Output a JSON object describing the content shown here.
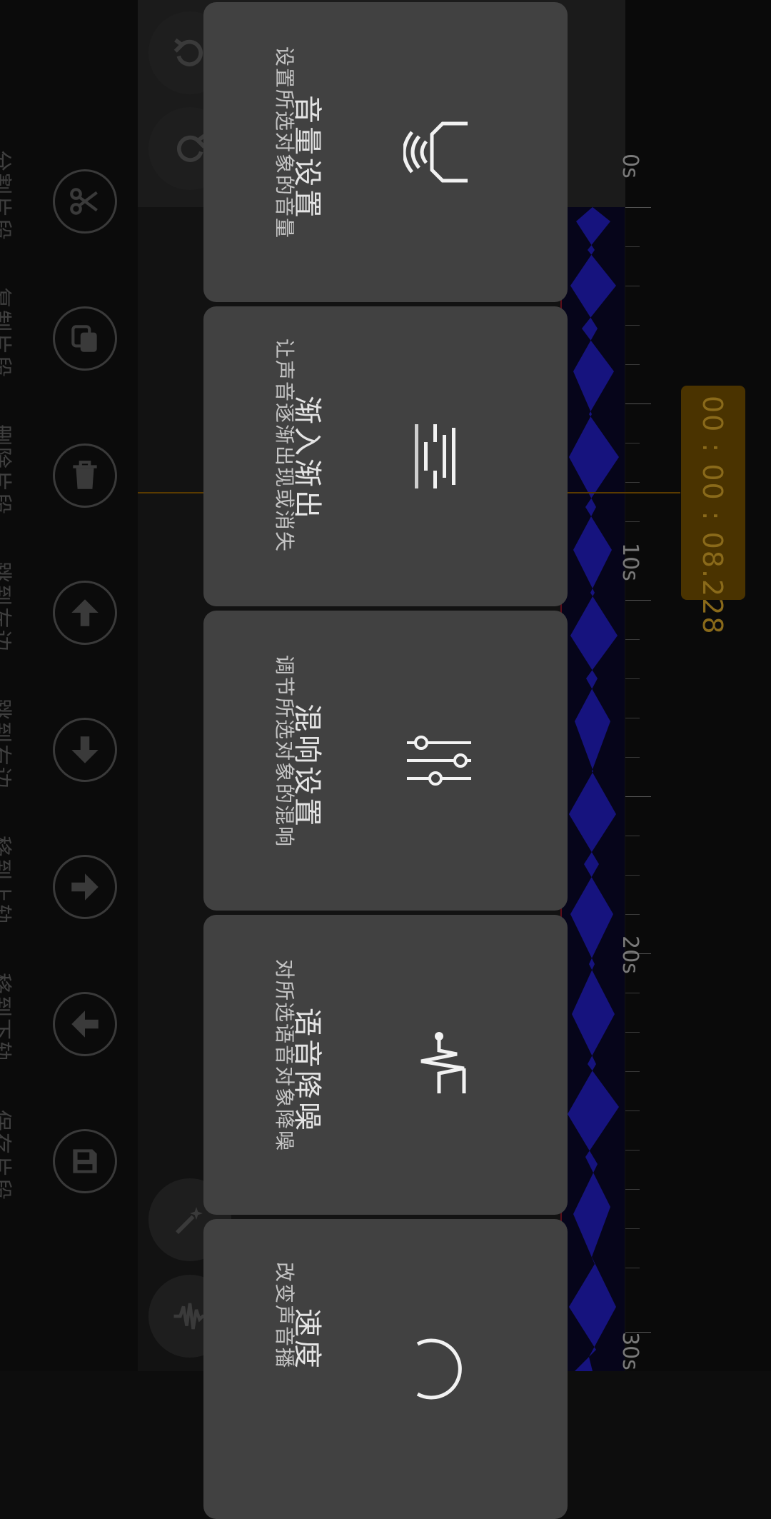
{
  "timeline": {
    "current_time": "00 : 00 : 08.228",
    "ruler_labels": [
      "0s",
      "10s",
      "20s",
      "30s"
    ]
  },
  "tools": [
    {
      "label": "分割片段",
      "icon": "scissors-icon"
    },
    {
      "label": "复制片段",
      "icon": "copy-icon"
    },
    {
      "label": "删除片段",
      "icon": "trash-icon"
    },
    {
      "label": "跳到左边",
      "icon": "arrow-up-icon"
    },
    {
      "label": "跳到右边",
      "icon": "arrow-down-icon"
    },
    {
      "label": "移到上轨",
      "icon": "arrow-right-icon"
    },
    {
      "label": "移到下轨",
      "icon": "arrow-left-icon"
    },
    {
      "label": "保存片段",
      "icon": "save-icon"
    }
  ],
  "menu": [
    {
      "title": "音量设置",
      "desc": "设置所选对象的音量",
      "icon": "speaker-icon"
    },
    {
      "title": "渐入渐出",
      "desc": "让声音逐渐出现或消失",
      "icon": "fade-icon"
    },
    {
      "title": "混响设置",
      "desc": "调节所选对象的混响",
      "icon": "sliders-icon"
    },
    {
      "title": "语音降噪",
      "desc": "对所选语音对象降噪",
      "icon": "noise-reduction-icon"
    },
    {
      "title": "速度",
      "desc": "改变声音播",
      "icon": "speedometer-icon"
    }
  ],
  "colors": {
    "card": "#414141",
    "waveform": "#1a1690",
    "time_badge": "#4a3300"
  }
}
